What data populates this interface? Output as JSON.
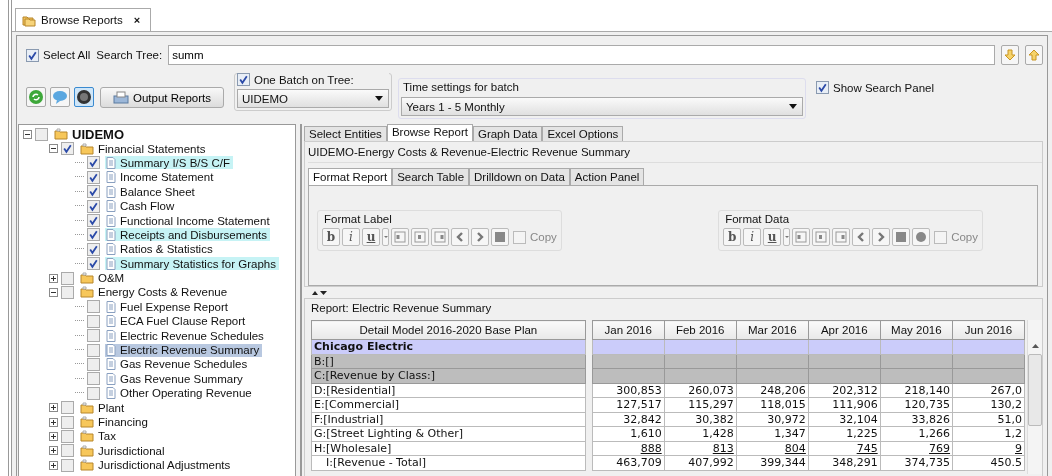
{
  "tab": {
    "title": "Browse Reports",
    "close": "×"
  },
  "search": {
    "select_all": {
      "label": "Select All",
      "checked": true
    },
    "label": "Search Tree:",
    "value": "summ"
  },
  "toolbar": {
    "icons": [
      {
        "kind": "recycle",
        "selected": false
      },
      {
        "kind": "bubble",
        "selected": false
      },
      {
        "kind": "knob",
        "selected": true
      }
    ],
    "output_button": "Output Reports",
    "batch": {
      "label": "One Batch on Tree:",
      "checked": true,
      "value": "UIDEMO"
    },
    "time": {
      "label": "Time settings for batch",
      "value": "Years 1 - 5 Monthly"
    },
    "show_panel": {
      "label": "Show Search Panel",
      "checked": true
    }
  },
  "tree": [
    {
      "label": "UIDEMO",
      "kind": "root",
      "checked": false,
      "expanded": true,
      "match": false,
      "selected": false,
      "children": [
        {
          "label": "Financial Statements",
          "kind": "folder",
          "checked": true,
          "expanded": true,
          "match": false,
          "selected": false,
          "children": [
            {
              "label": "Summary I/S B/S C/F",
              "kind": "report",
              "checked": true,
              "match": true,
              "selected": false
            },
            {
              "label": "Income Statement",
              "kind": "report",
              "checked": true,
              "match": false,
              "selected": false
            },
            {
              "label": "Balance Sheet",
              "kind": "report",
              "checked": true,
              "match": false,
              "selected": false
            },
            {
              "label": "Cash Flow",
              "kind": "report",
              "checked": true,
              "match": false,
              "selected": false
            },
            {
              "label": "Functional Income Statement",
              "kind": "report",
              "checked": true,
              "match": false,
              "selected": false
            },
            {
              "label": "Receipts and Disbursements",
              "kind": "report",
              "checked": true,
              "match": true,
              "selected": false
            },
            {
              "label": "Ratios & Statistics",
              "kind": "report",
              "checked": true,
              "match": false,
              "selected": false
            },
            {
              "label": "Summary Statistics for Graphs",
              "kind": "report",
              "checked": true,
              "match": true,
              "selected": false
            }
          ]
        },
        {
          "label": "O&M",
          "kind": "folder",
          "checked": false,
          "expanded": false,
          "match": false,
          "selected": false
        },
        {
          "label": "Energy Costs & Revenue",
          "kind": "folder",
          "checked": false,
          "expanded": true,
          "match": false,
          "selected": false,
          "children": [
            {
              "label": "Fuel Expense Report",
              "kind": "report",
              "checked": false,
              "match": false,
              "selected": false
            },
            {
              "label": "ECA Fuel Clause Report",
              "kind": "report",
              "checked": false,
              "match": false,
              "selected": false
            },
            {
              "label": "Electric Revenue Schedules",
              "kind": "report",
              "checked": false,
              "match": false,
              "selected": false
            },
            {
              "label": "Electric Revenue Summary",
              "kind": "report",
              "checked": false,
              "match": false,
              "selected": true
            },
            {
              "label": "Gas Revenue Schedules",
              "kind": "report",
              "checked": false,
              "match": false,
              "selected": false
            },
            {
              "label": "Gas Revenue Summary",
              "kind": "report",
              "checked": false,
              "match": false,
              "selected": false
            },
            {
              "label": "Other Operating Revenue",
              "kind": "report",
              "checked": false,
              "match": false,
              "selected": false
            }
          ]
        },
        {
          "label": "Plant",
          "kind": "folder",
          "checked": false,
          "expanded": false,
          "match": false,
          "selected": false
        },
        {
          "label": "Financing",
          "kind": "folder",
          "checked": false,
          "expanded": false,
          "match": false,
          "selected": false
        },
        {
          "label": "Tax",
          "kind": "folder",
          "checked": false,
          "expanded": false,
          "match": false,
          "selected": false
        },
        {
          "label": "Jurisdictional",
          "kind": "folder",
          "checked": false,
          "expanded": false,
          "match": false,
          "selected": false
        },
        {
          "label": "Jurisdictional Adjustments",
          "kind": "folder",
          "checked": false,
          "expanded": false,
          "match": false,
          "selected": false
        }
      ]
    }
  ],
  "main_tabs": [
    {
      "label": "Select Entities",
      "selected": false
    },
    {
      "label": "Browse Report",
      "selected": true
    },
    {
      "label": "Graph Data",
      "selected": false
    },
    {
      "label": "Excel Options",
      "selected": false
    }
  ],
  "report_path": "UIDEMO-Energy Costs & Revenue-Electric Revenue Summary",
  "sub_tabs": [
    {
      "label": "Format Report",
      "selected": true
    },
    {
      "label": "Search Table",
      "selected": false
    },
    {
      "label": "Drilldown on Data",
      "selected": false
    },
    {
      "label": "Action Panel",
      "selected": false
    }
  ],
  "format_groups": [
    {
      "title": "Format Label",
      "copy": {
        "label": "Copy",
        "checked": false
      },
      "tools": [
        {
          "kind": "glyph",
          "glyph": "b"
        },
        {
          "kind": "glyph",
          "glyph": "i"
        },
        {
          "kind": "glyph",
          "glyph": "u"
        },
        {
          "kind": "caret"
        },
        {
          "kind": "align-left"
        },
        {
          "kind": "align-center"
        },
        {
          "kind": "align-right"
        },
        {
          "kind": "prev"
        },
        {
          "kind": "next"
        },
        {
          "kind": "fill"
        }
      ]
    },
    {
      "title": "Format Data",
      "copy": {
        "label": "Copy",
        "checked": false
      },
      "tools": [
        {
          "kind": "glyph",
          "glyph": "b"
        },
        {
          "kind": "glyph",
          "glyph": "i"
        },
        {
          "kind": "glyph",
          "glyph": "u"
        },
        {
          "kind": "caret"
        },
        {
          "kind": "align-left"
        },
        {
          "kind": "align-center"
        },
        {
          "kind": "align-right"
        },
        {
          "kind": "prev"
        },
        {
          "kind": "next"
        },
        {
          "kind": "fill"
        },
        {
          "kind": "circle"
        }
      ]
    }
  ],
  "report": {
    "title": "Report: Electric Revenue Summary",
    "label_header": "Detail Model 2016-2020 Base Plan",
    "columns": [
      "Jan 2016",
      "Feb 2016",
      "Mar 2016",
      "Apr 2016",
      "May 2016",
      "Jun 2016"
    ],
    "rows": [
      {
        "label": "Chicago Electric",
        "kind": "entity",
        "values": []
      },
      {
        "label": "B:[]",
        "kind": "group",
        "values": []
      },
      {
        "label": "C:[Revenue by Class:]",
        "kind": "group",
        "values": []
      },
      {
        "label": "D:[Residential]",
        "kind": "data",
        "values": [
          "300,853",
          "260,073",
          "248,206",
          "202,312",
          "218,140",
          "267,0"
        ]
      },
      {
        "label": "E:[Commercial]",
        "kind": "data",
        "values": [
          "127,517",
          "115,297",
          "118,015",
          "111,906",
          "120,735",
          "130,2"
        ]
      },
      {
        "label": "F:[Industrial]",
        "kind": "data",
        "values": [
          "32,842",
          "30,382",
          "30,972",
          "32,104",
          "33,826",
          "51,0"
        ]
      },
      {
        "label": "G:[Street Lighting & Other]",
        "kind": "data",
        "values": [
          "1,610",
          "1,428",
          "1,347",
          "1,225",
          "1,266",
          "1,2"
        ]
      },
      {
        "label": "H:[Wholesale]",
        "kind": "underlined",
        "values": [
          "888",
          "813",
          "804",
          "745",
          "769",
          "9"
        ]
      },
      {
        "label": "I:[Revenue - Total]",
        "kind": "total",
        "values": [
          "463,709",
          "407,992",
          "399,344",
          "348,291",
          "374,735",
          "450.5"
        ]
      }
    ]
  }
}
